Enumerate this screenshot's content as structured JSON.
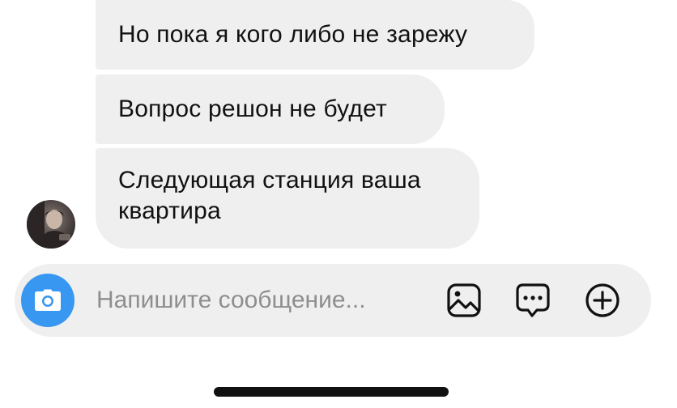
{
  "messages": [
    {
      "text": "Но пока я кого либо не зарежу"
    },
    {
      "text": "Вопрос решон не будет"
    },
    {
      "text": "Следующая станция ваша\nквартира"
    }
  ],
  "composer": {
    "placeholder": "Напишите сообщение...",
    "icons": [
      "camera-icon",
      "gallery-icon",
      "sticker-icon",
      "plus-icon"
    ]
  },
  "colors": {
    "bubble": "#efefef",
    "camera_button": "#3897f0",
    "placeholder_text": "#8e8e8e",
    "text": "#111111"
  }
}
